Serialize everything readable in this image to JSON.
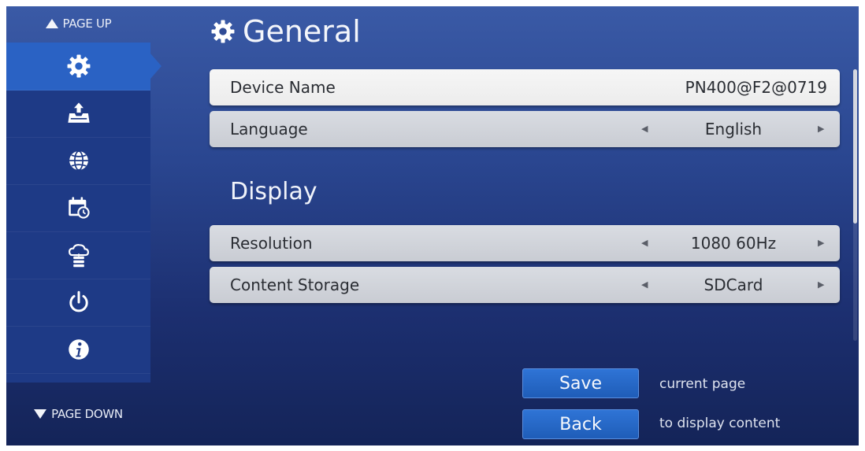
{
  "nav": {
    "page_up": "PAGE UP",
    "page_down": "PAGE DOWN"
  },
  "sidebar": {
    "items": [
      {
        "icon": "gear-icon",
        "active": true
      },
      {
        "icon": "upload-tray-icon",
        "active": false
      },
      {
        "icon": "globe-icon",
        "active": false
      },
      {
        "icon": "calendar-clock-icon",
        "active": false
      },
      {
        "icon": "cloud-server-icon",
        "active": false
      },
      {
        "icon": "power-icon",
        "active": false
      },
      {
        "icon": "info-icon",
        "active": false
      }
    ]
  },
  "header": {
    "title": "General",
    "icon": "gear-icon"
  },
  "general": {
    "device_name_label": "Device Name",
    "device_name_value": "PN400@F2@0719",
    "language_label": "Language",
    "language_value": "English"
  },
  "display": {
    "section_title": "Display",
    "resolution_label": "Resolution",
    "resolution_value": "1080 60Hz",
    "storage_label": "Content Storage",
    "storage_value": "SDCard"
  },
  "actions": {
    "save_label": "Save",
    "save_note": "current page",
    "back_label": "Back",
    "back_note": "to display content"
  },
  "colors": {
    "background": "#2a4690",
    "sidebar": "#1e3a86",
    "active_item": "#2a62c4",
    "button": "#1f5db8"
  }
}
